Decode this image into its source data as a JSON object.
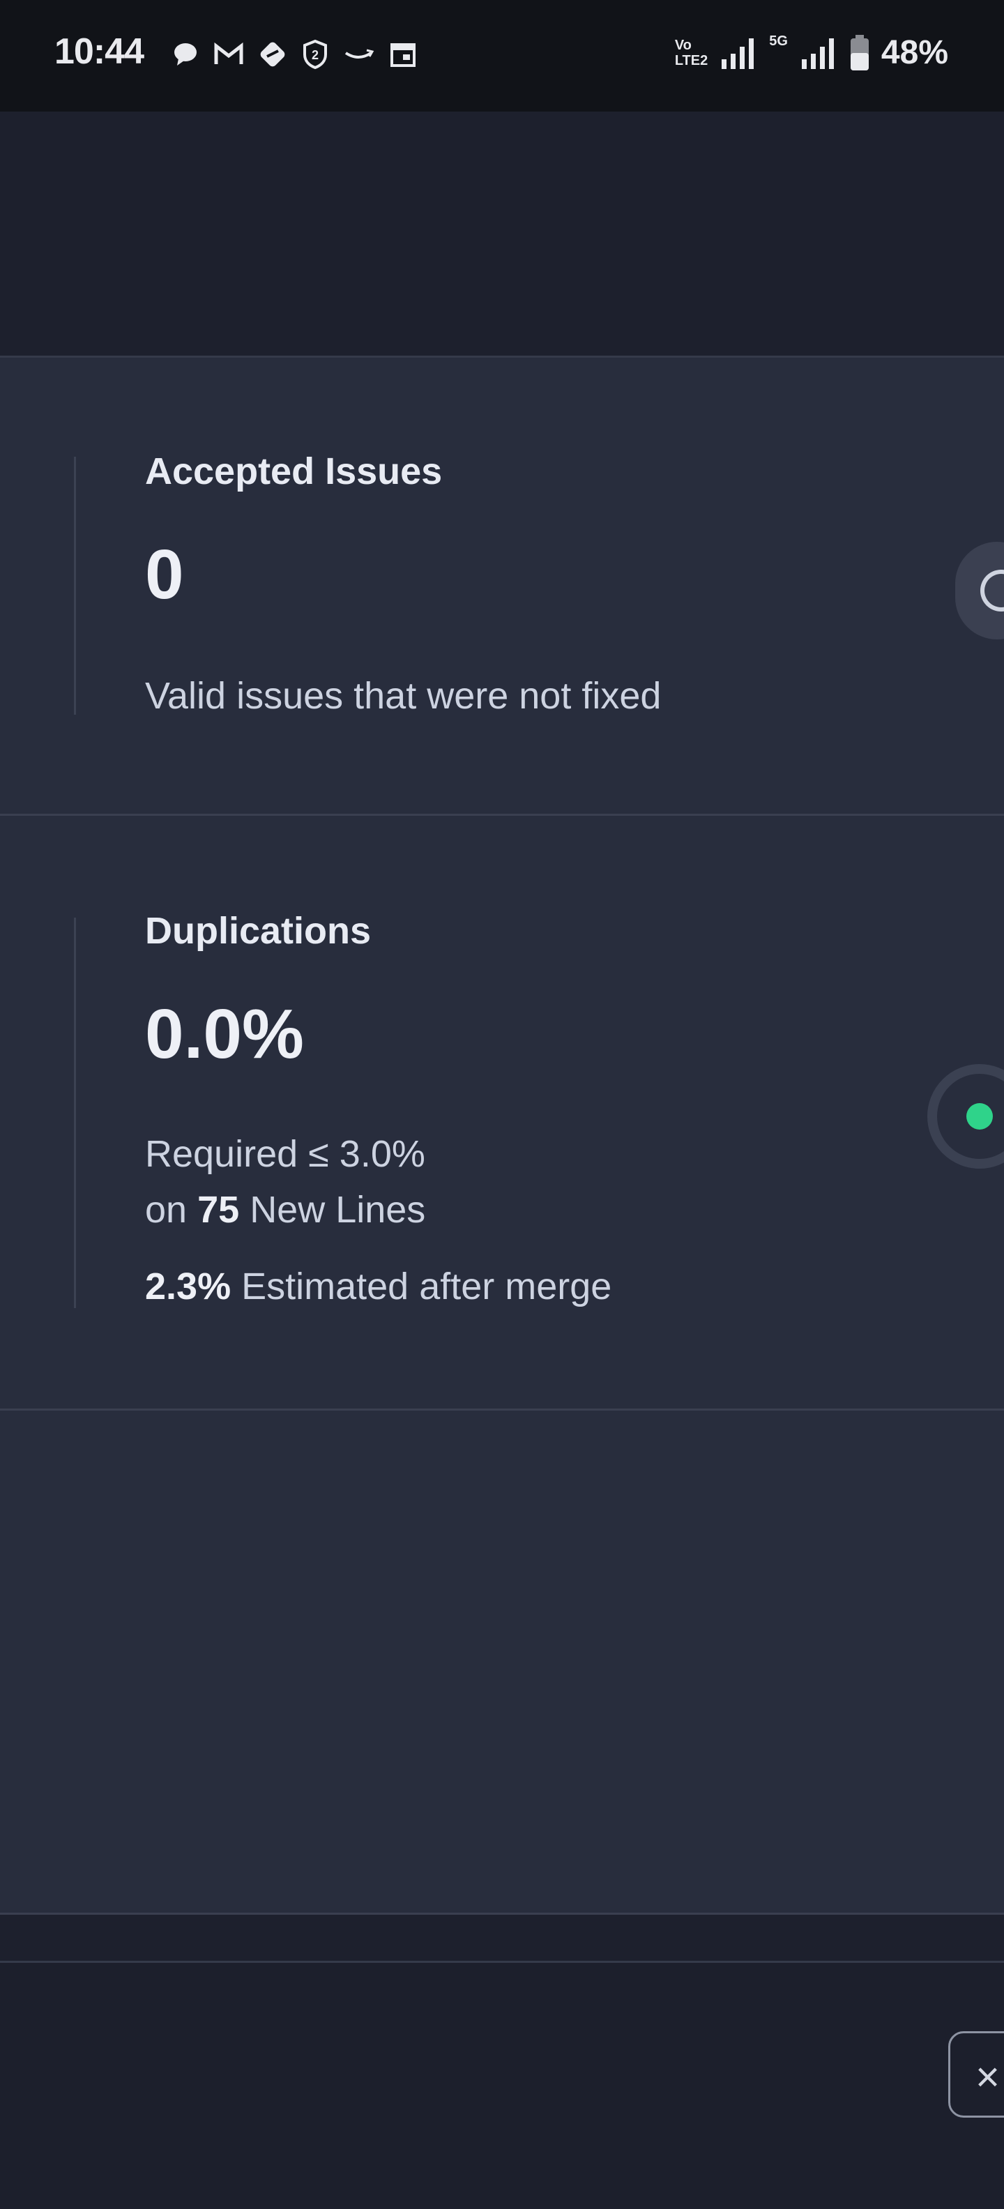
{
  "status_bar": {
    "time": "10:44",
    "notification_icons": [
      "chat-bubble-icon",
      "gmail-icon",
      "badge-icon",
      "shield-2-icon",
      "amazon-icon",
      "calendar-icon"
    ],
    "network": {
      "volte_line1": "Vo",
      "volte_line2": "LTE2",
      "network_type": "5G"
    },
    "battery_percent": "48%"
  },
  "accepted_issues": {
    "title": "Accepted Issues",
    "value": "0",
    "description": "Valid issues that were not fixed"
  },
  "duplications": {
    "title": "Duplications",
    "value": "0.0%",
    "required_text": "Required ≤ 3.0%",
    "lines_prefix": "on",
    "new_lines_count": "75",
    "lines_suffix": "New Lines",
    "estimated_value": "2.3%",
    "estimated_text": "Estimated after merge",
    "status_color": "#2fd38a"
  },
  "footer": {
    "close_label": "×"
  }
}
